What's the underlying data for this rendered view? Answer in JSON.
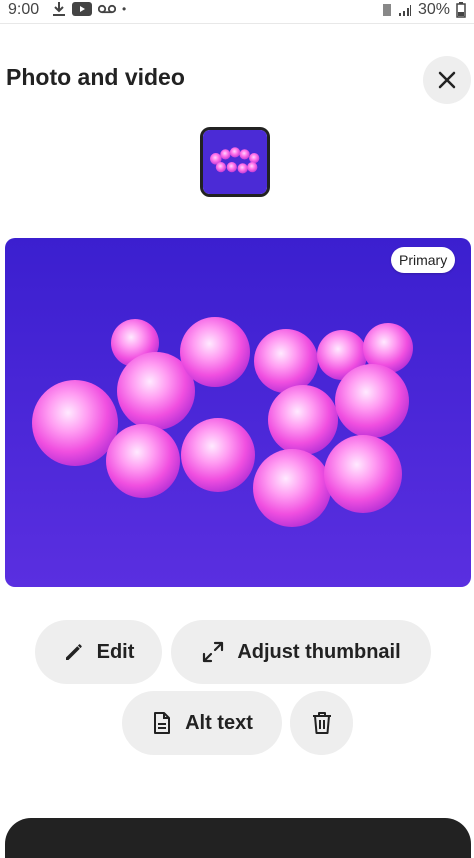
{
  "status_bar": {
    "time": "9:00",
    "battery": "30%"
  },
  "header": {
    "title": "Photo and video"
  },
  "photo": {
    "badge": "Primary"
  },
  "actions": {
    "edit": "Edit",
    "adjust_thumbnail": "Adjust thumbnail",
    "alt_text": "Alt text"
  },
  "icons": {
    "close": "close-icon",
    "edit": "pencil-icon",
    "adjust": "expand-arrows-icon",
    "alt_text": "document-icon",
    "delete": "trash-icon"
  },
  "colors": {
    "pill_bg": "#eeeeee",
    "photo_bg": "#4b2bd6",
    "marble": "#ff6fe9"
  }
}
